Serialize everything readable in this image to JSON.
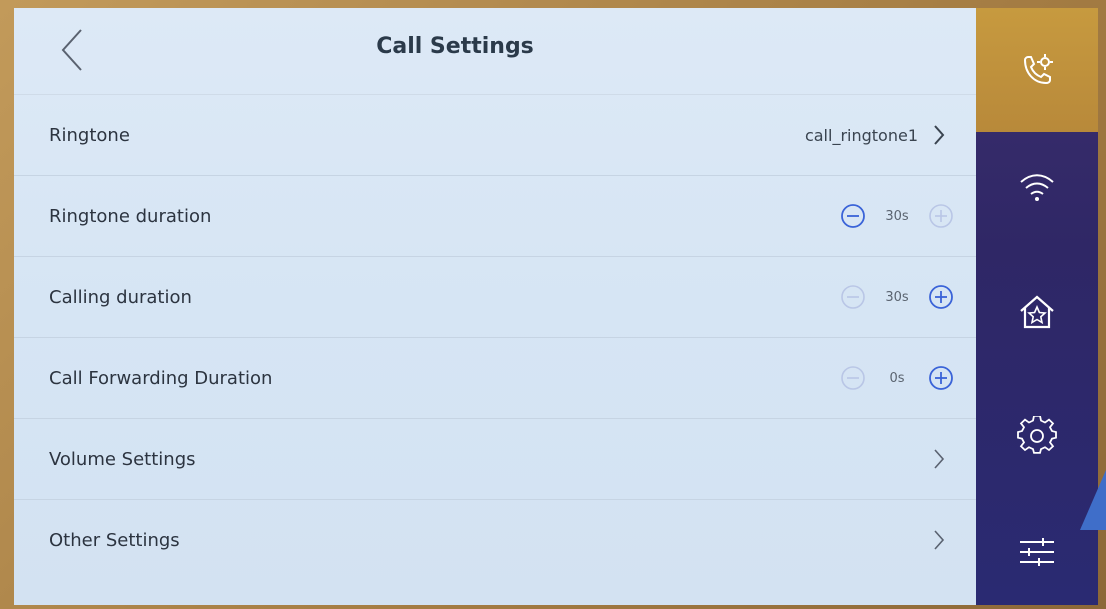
{
  "header": {
    "title": "Call Settings",
    "back_icon": "chevron-left-icon"
  },
  "rows": {
    "ringtone": {
      "label": "Ringtone",
      "value": "call_ringtone1"
    },
    "ringtone_duration": {
      "label": "Ringtone duration",
      "value": "30s",
      "minus_enabled": true,
      "plus_enabled": false
    },
    "calling_duration": {
      "label": "Calling duration",
      "value": "30s",
      "minus_enabled": false,
      "plus_enabled": true
    },
    "call_forwarding_duration": {
      "label": "Call Forwarding Duration",
      "value": "0s",
      "minus_enabled": false,
      "plus_enabled": true
    },
    "volume_settings": {
      "label": "Volume Settings"
    },
    "other_settings": {
      "label": "Other Settings"
    }
  },
  "nav": {
    "items": [
      {
        "icon": "call-settings-icon",
        "active": true
      },
      {
        "icon": "wifi-icon",
        "active": false
      },
      {
        "icon": "home-icon",
        "active": false
      },
      {
        "icon": "gear-icon",
        "active": false
      },
      {
        "icon": "sliders-icon",
        "active": false
      }
    ]
  },
  "colors": {
    "panel_bg": "#d8e6f5",
    "nav_bg": "#2f2766",
    "nav_active": "#c79a3f",
    "stepper_active": "#3a63d8",
    "stepper_disabled": "#b9c6e6",
    "text_primary": "#2c3440"
  }
}
